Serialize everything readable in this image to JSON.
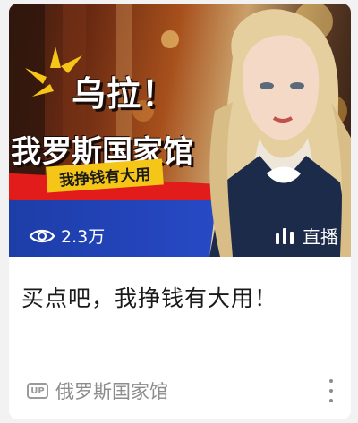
{
  "video": {
    "thumbnail": {
      "headline": "乌拉！",
      "channel_title": "我罗斯国家馆",
      "ribbon": "我挣钱有大用"
    },
    "views": "2.3万",
    "live_label": "直播",
    "title": "买点吧，我挣钱有大用！",
    "author": "俄罗斯国家馆",
    "up_badge": "UP"
  },
  "icons": {
    "views": "eye-icon",
    "live": "live-bars-icon",
    "up": "up-badge-icon",
    "more": "more-vertical-icon"
  },
  "colors": {
    "card_bg": "#ffffff",
    "page_bg": "#f2f2f2",
    "ribbon": "#f5c518",
    "band_red": "#e21b1b",
    "band_blue": "#2749c4",
    "meta_text": "#8c8c8c"
  }
}
